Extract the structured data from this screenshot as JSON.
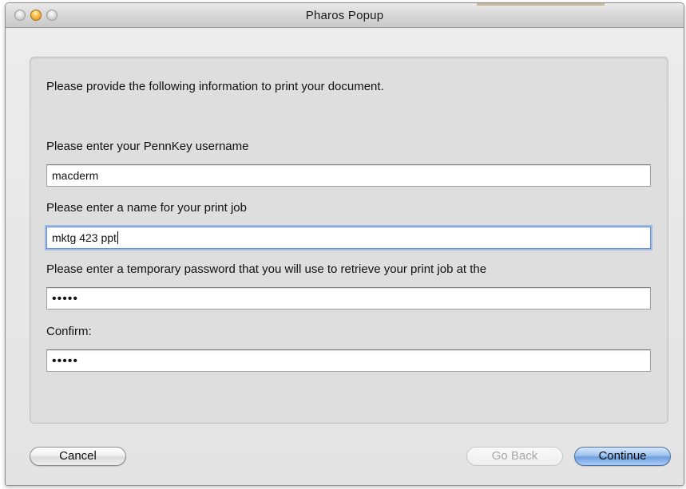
{
  "window": {
    "title": "Pharos Popup"
  },
  "form": {
    "intro": "Please provide the following information to print your document.",
    "username_label": "Please enter your PennKey username",
    "username_value": "macderm",
    "jobname_label": "Please enter a name for your print job",
    "jobname_value": "mktg 423 ppt",
    "password_label": "Please enter a temporary password that you will use to retrieve your print job at the",
    "password_value": "•••••",
    "confirm_label": "Confirm:",
    "confirm_value": "•••••"
  },
  "buttons": {
    "cancel": "Cancel",
    "go_back": "Go Back",
    "continue": "Continue"
  },
  "colors": {
    "window_bg": "#e8e8e8",
    "focus_ring": "#9cbbe8",
    "default_button": "#6f9fe0"
  }
}
